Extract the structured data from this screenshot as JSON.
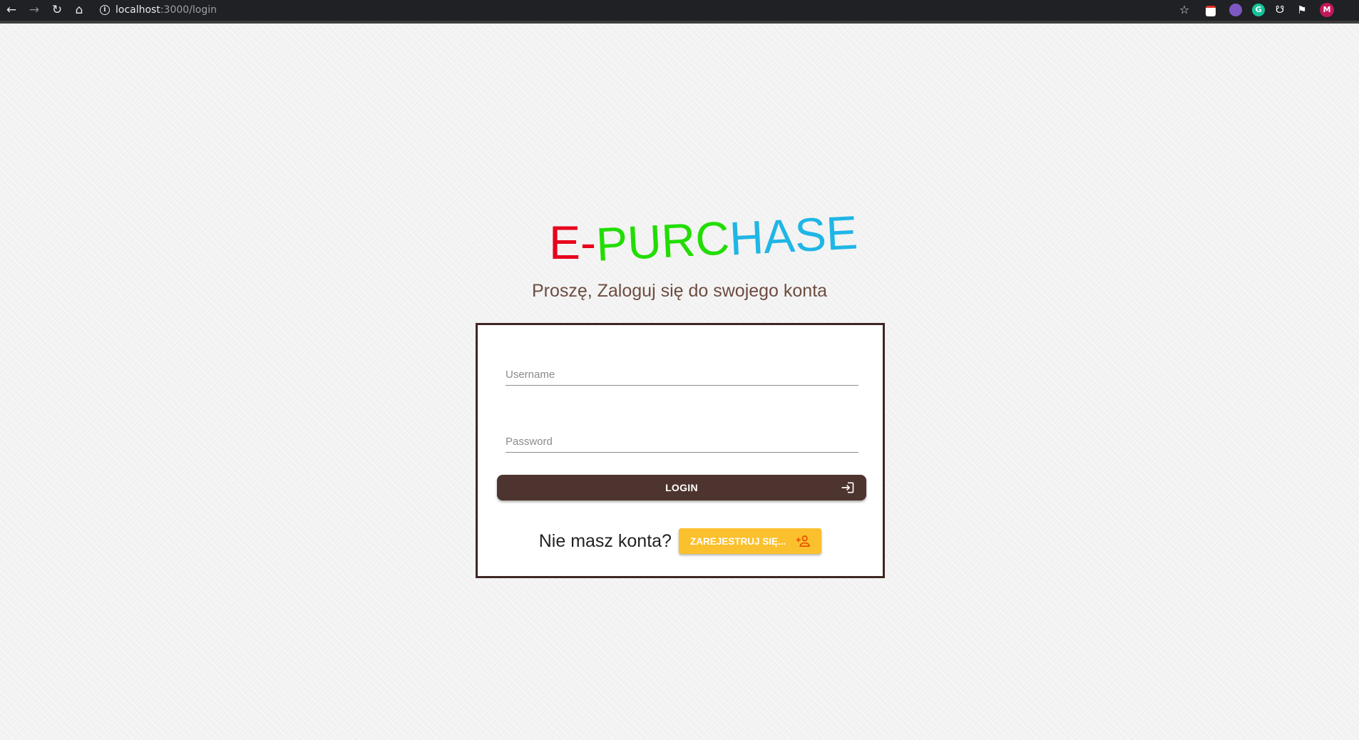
{
  "browser": {
    "url_host": "localhost",
    "url_path": ":3000/login",
    "profile_initial": "M"
  },
  "logo": {
    "text_parts": [
      {
        "text": "E-",
        "color": "#e8001c"
      },
      {
        "text": "PURC",
        "color": "#22dd00"
      },
      {
        "text": "HASE",
        "color": "#1fb6e6"
      }
    ]
  },
  "subtitle": "Proszę, Zaloguj się do swojego konta",
  "form": {
    "username_placeholder": "Username",
    "password_placeholder": "Password",
    "login_label": "LOGIN",
    "no_account_text": "Nie masz konta?",
    "register_label": "ZAREJESTRUJ SIĘ..."
  },
  "colors": {
    "card_border": "#3e2723",
    "login_bg": "#4e342e",
    "register_bg": "#fbc02d",
    "subtitle": "#6d4c41"
  }
}
